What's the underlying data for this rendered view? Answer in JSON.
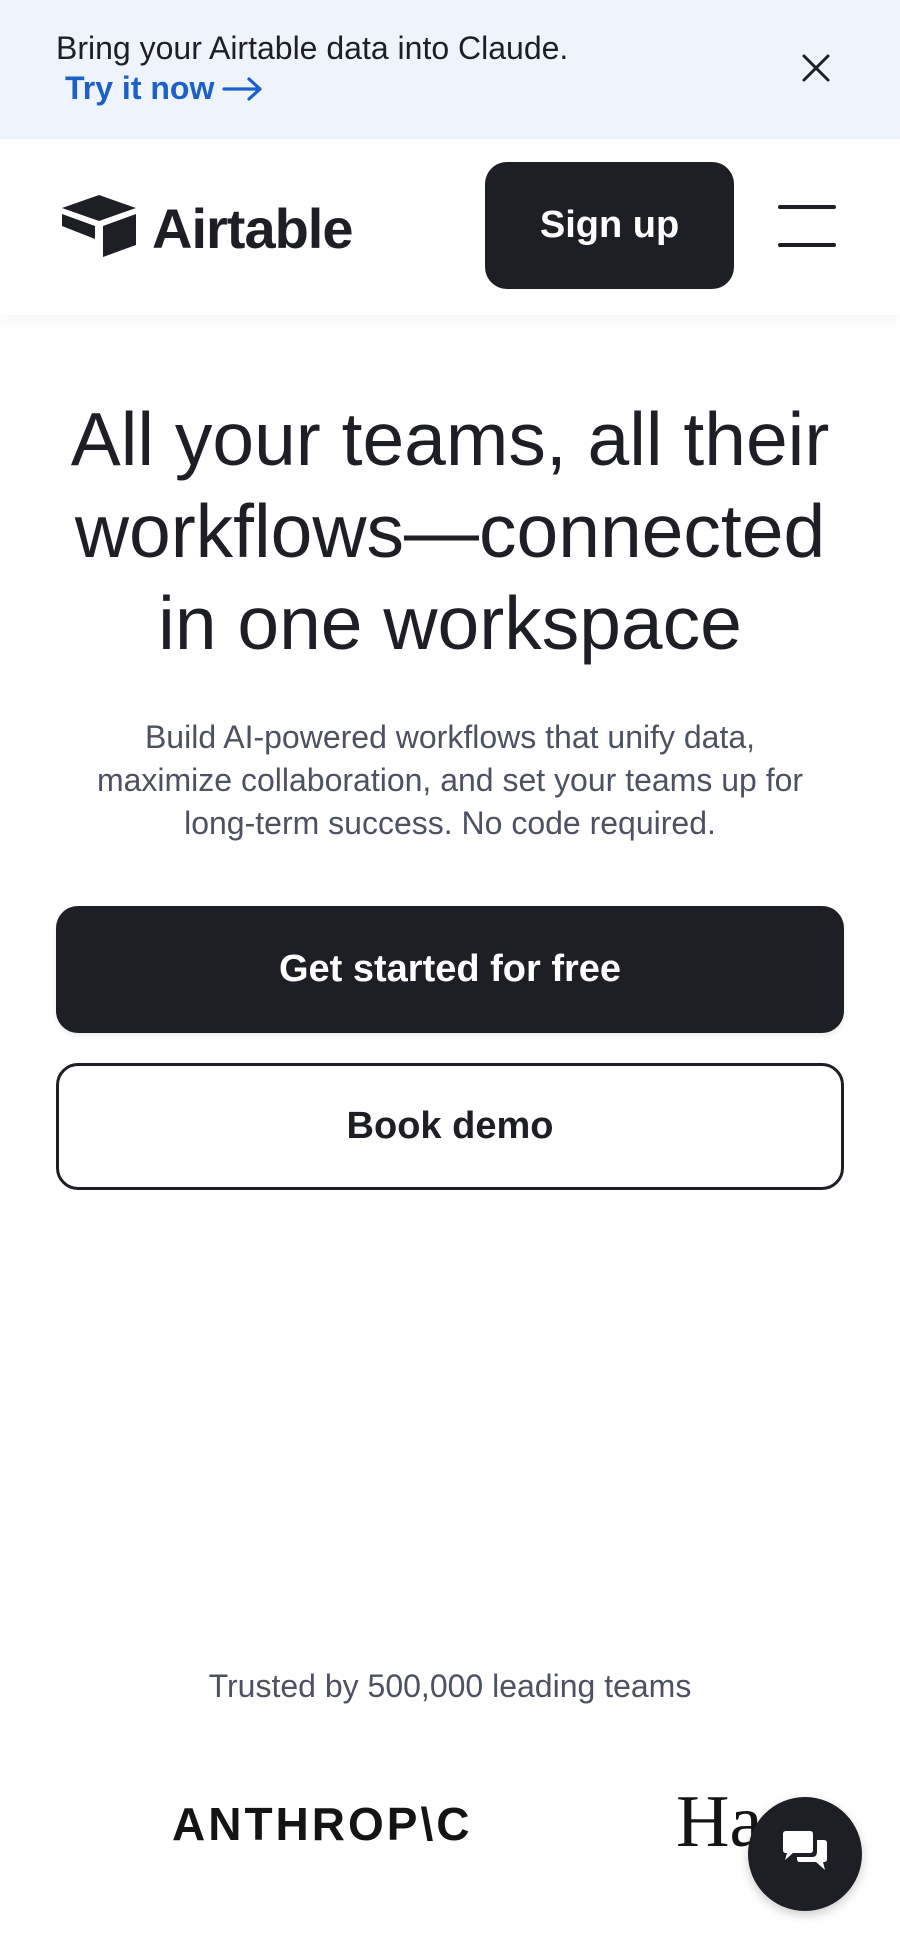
{
  "banner": {
    "text": "Bring your Airtable data into Claude.",
    "link_label": "Try it now",
    "link_icon": "arrow-right-icon",
    "close_icon": "close-icon"
  },
  "header": {
    "logo_text": "Airtable",
    "logo_icon": "airtable-box-icon",
    "signup_label": "Sign up",
    "menu_icon": "hamburger-menu-icon"
  },
  "hero": {
    "title_lines": [
      "All your teams, all their",
      "workflows—connected",
      "in one workspace"
    ],
    "subtitle_lines": [
      "Build AI-powered workflows that unify data,",
      "maximize collaboration, and set your teams up for",
      "long-term success. No code required."
    ],
    "primary_cta": "Get started for free",
    "secondary_cta": "Book demo"
  },
  "trusted": {
    "text": "Trusted by 500,000 leading teams",
    "logos": [
      "ANTHROP\\C",
      "Ha"
    ]
  },
  "chat": {
    "icon": "chat-bubbles-icon"
  },
  "colors": {
    "banner_bg": "#eef3fc",
    "link_blue": "#1b61c9",
    "dark": "#1d1f25",
    "muted_text": "#4c5261"
  }
}
